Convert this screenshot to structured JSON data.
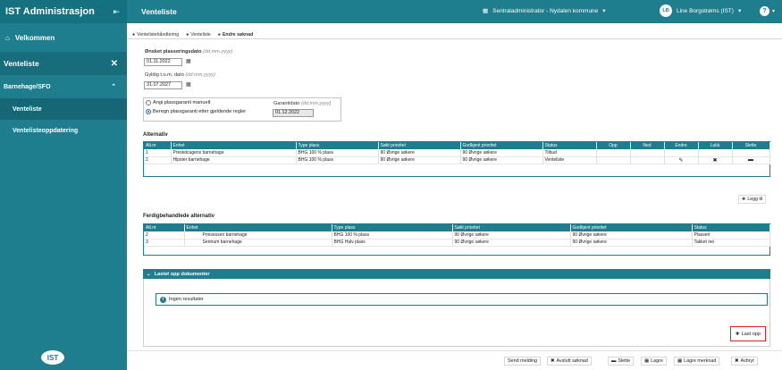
{
  "app": {
    "title": "IST Administrasjon",
    "logo_text": "IST"
  },
  "sidebar": {
    "home_label": "Velkommen",
    "module_label": "Venteliste",
    "group_label": "Barnehage/SFO",
    "items": [
      {
        "label": "Venteliste"
      },
      {
        "label": "Venteliste­oppdatering"
      }
    ]
  },
  "topbar": {
    "page_title": "Venteliste",
    "org_label": "Sentraladministrator - Nydalen kommune",
    "user_initials": "LB",
    "user_name": "Line Borgstrøms (IST)",
    "help_label": "?"
  },
  "breadcrumb": [
    {
      "label": "Ventelistehåndtering"
    },
    {
      "label": "Venteliste"
    },
    {
      "label": "Endre søknad"
    }
  ],
  "form": {
    "desired_date_label": "Ønsket plasseringsdato",
    "desired_date_hint": "(dd.mm.yyyy)",
    "desired_date_value": "01.11.2022",
    "valid_to_label": "Gyldig t.o.m. dato",
    "valid_to_hint": "(dd.mm.yyyy)",
    "valid_to_value": "31.07.2027",
    "radio_manual_label": "Angi plassgaranti manuelt",
    "radio_calc_label": "Beregn plassgaranti etter gjeldende regler",
    "guarantee_label": "Garantidato",
    "guarantee_hint": "(dd.mm.yyyy)",
    "guarantee_value": "01.12.2022"
  },
  "alternatives": {
    "title": "Alternativ",
    "columns": [
      "Alt.nr",
      "Enhet",
      "Type plass",
      "Søkt prioritet",
      "Godkjent prioritet",
      "Status",
      "Opp",
      "Ned",
      "Endre",
      "Lukk",
      "Slette"
    ],
    "rows": [
      {
        "nr": "1",
        "enhet": "Prestelcagens barnehage",
        "type": "BHG 100 % plass",
        "sokt": "90 Øvrige søkere",
        "godkjent": "90 Øvrige søkere",
        "status": "Tilbud"
      },
      {
        "nr": "2",
        "enhet": "Hipster barnehage",
        "type": "BHG 100 % plass",
        "sokt": "90 Øvrige søkere",
        "godkjent": "90 Øvrige søkere",
        "status": "Venteliste"
      }
    ],
    "add_label": "Legg til"
  },
  "finished": {
    "title": "Ferdigbehandlede alternativ",
    "columns": [
      "Alt.nr",
      "Enhet",
      "Type plass",
      "Søkt prioritet",
      "Godkjent prioritet",
      "Status"
    ],
    "rows": [
      {
        "nr": "2",
        "enhet": "Prinsessen barnehage",
        "type": "BHG 100 % plass",
        "sokt": "90 Øvrige søkere",
        "godkjent": "90 Øvrige søkere",
        "status": "Plassert"
      },
      {
        "nr": "3",
        "enhet": "Sentrum barnehage",
        "type": "BHG Halv plass",
        "sokt": "90 Øvrige søkere",
        "godkjent": "90 Øvrige søkere",
        "status": "Takket nei"
      }
    ]
  },
  "documents": {
    "title": "Lastet opp dokumenter",
    "empty_label": "Ingen resultater",
    "upload_label": "Last opp"
  },
  "footer": {
    "send_label": "Send melding",
    "reject_label": "Avslutt søknad",
    "delete_label": "Slette",
    "save_label": "Lagre",
    "save_note_label": "Lagre merknad",
    "cancel_label": "Avbryt"
  }
}
